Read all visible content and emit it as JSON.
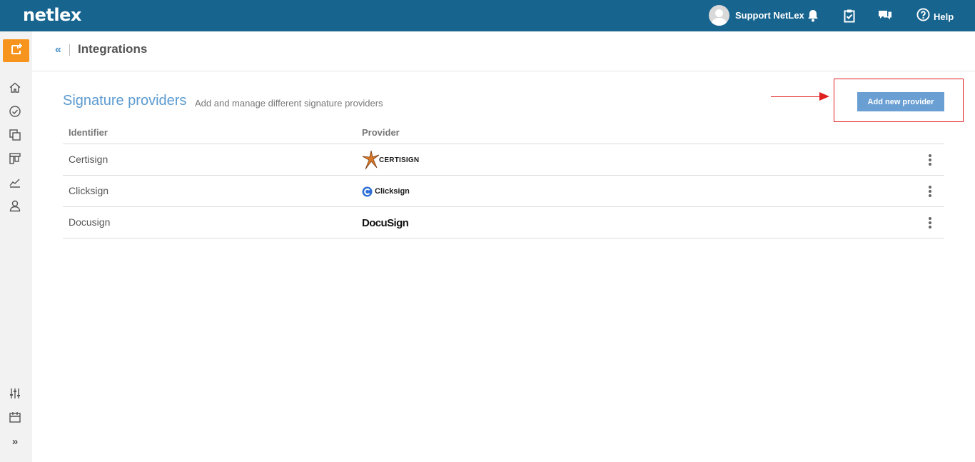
{
  "topbar": {
    "logo": "netlex",
    "user_name": "Support NetLex",
    "help_label": "Help",
    "icons": [
      "bell-icon",
      "clipboard-check-icon",
      "chat-icon",
      "help-circle-icon"
    ]
  },
  "sidebar": {
    "icons": [
      "new-item-icon",
      "home-icon",
      "dashboard-icon",
      "documents-icon",
      "kanban-icon",
      "chart-icon",
      "user-icon",
      "settings-sliders-icon",
      "calendar-icon",
      "expand-icon"
    ],
    "expand_label": "»"
  },
  "header": {
    "back_label": "«",
    "title": "Integrations"
  },
  "section": {
    "title": "Signature providers",
    "subtitle": "Add and manage different signature providers",
    "add_button_label": "Add new provider"
  },
  "table": {
    "columns": [
      "Identifier",
      "Provider"
    ],
    "rows": [
      {
        "identifier": "Certisign",
        "provider": "CERTISIGN"
      },
      {
        "identifier": "Clicksign",
        "provider": "Clicksign"
      },
      {
        "identifier": "Docusign",
        "provider": "DocuSign"
      }
    ]
  },
  "colors": {
    "topbar": "#17648f",
    "accent": "#5b9ad0",
    "button": "#6a9fd3",
    "new_item": "#f7941d",
    "annotation": "#e01f1f"
  }
}
